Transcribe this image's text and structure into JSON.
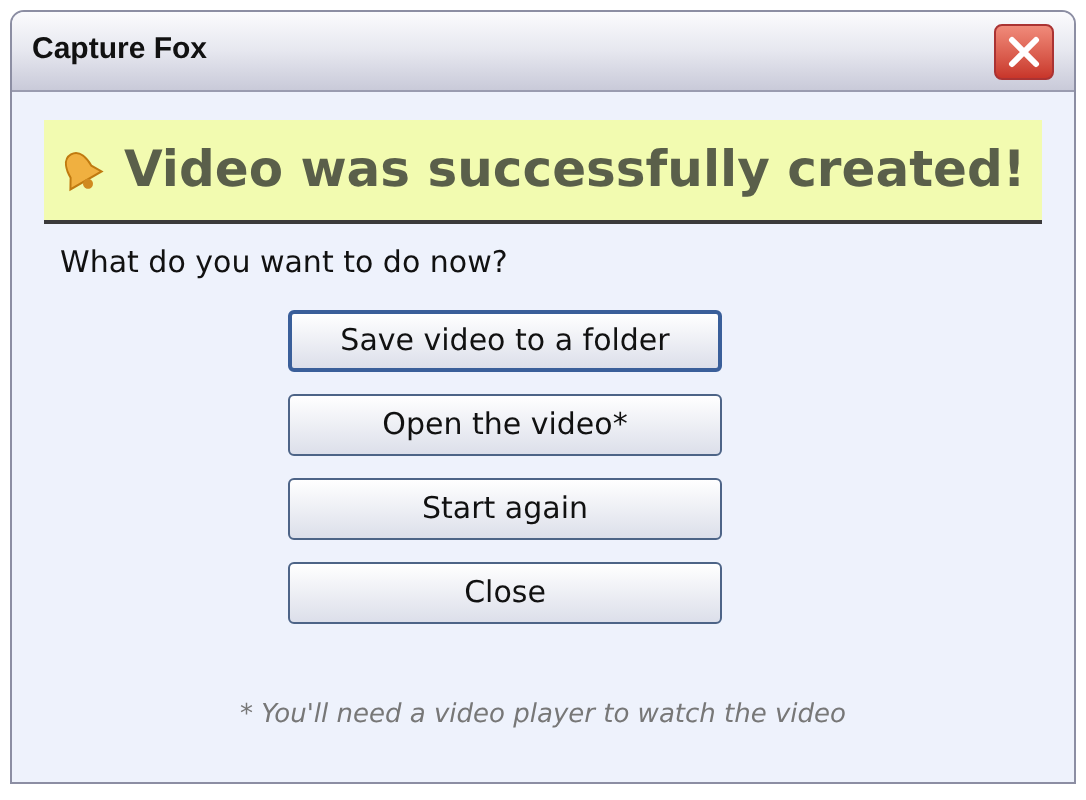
{
  "window": {
    "title": "Capture Fox"
  },
  "banner": {
    "text": "Video was successfully created!"
  },
  "question": "What do you want to do now?",
  "buttons": [
    {
      "label": "Save video to a folder",
      "focused": true
    },
    {
      "label": "Open the video*",
      "focused": false
    },
    {
      "label": "Start again",
      "focused": false
    },
    {
      "label": "Close",
      "focused": false
    }
  ],
  "footnote": "* You'll need a video player to watch the video"
}
